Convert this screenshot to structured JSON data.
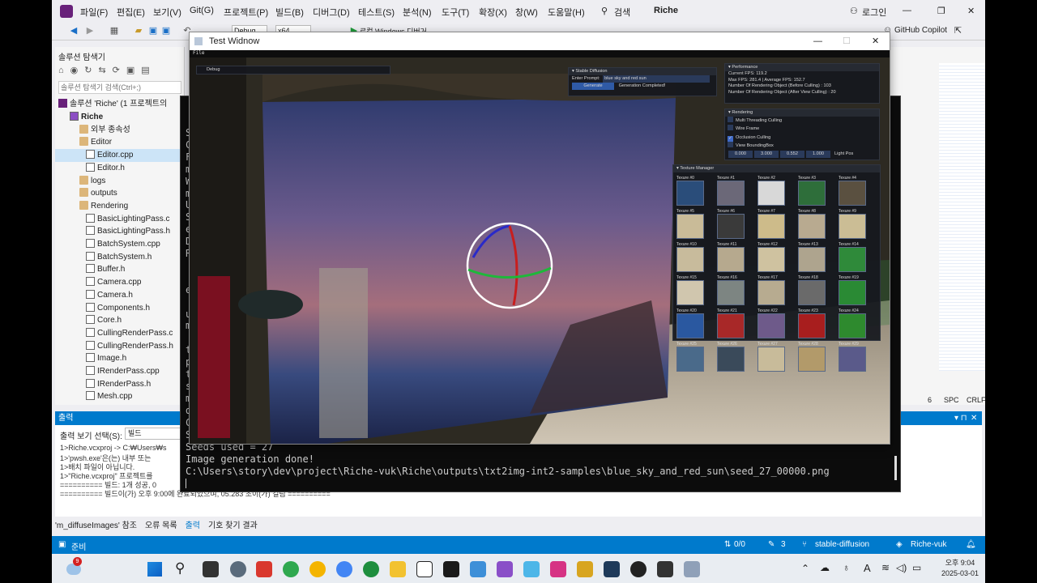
{
  "vs": {
    "menus": [
      "파일(F)",
      "편집(E)",
      "보기(V)",
      "Git(G)",
      "프로젝트(P)",
      "빌드(B)",
      "디버그(D)",
      "테스트(S)",
      "분석(N)",
      "도구(T)",
      "확장(X)",
      "창(W)",
      "도움말(H)"
    ],
    "search_label": "검색",
    "solution_name": "Riche",
    "login_label": "로그인",
    "copilot_label": "GitHub Copilot",
    "config": "Debug",
    "platform": "x64",
    "run_label": "로컬 Windows 디버거"
  },
  "solution_explorer": {
    "title": "솔루션 탐색기",
    "search_placeholder": "솔루션 탐색기 검색(Ctrl+;)",
    "solution_label": "솔루션 'Riche' (1 프로젝트의",
    "items": [
      {
        "label": "Riche",
        "kind": "project"
      },
      {
        "label": "외부 종속성",
        "kind": "folder"
      },
      {
        "label": "Editor",
        "kind": "folder"
      },
      {
        "label": "Editor.cpp",
        "kind": "file"
      },
      {
        "label": "Editor.h",
        "kind": "file"
      },
      {
        "label": "logs",
        "kind": "folder"
      },
      {
        "label": "outputs",
        "kind": "folder"
      },
      {
        "label": "Rendering",
        "kind": "folder"
      },
      {
        "label": "BasicLightingPass.c",
        "kind": "file"
      },
      {
        "label": "BasicLightingPass.h",
        "kind": "file"
      },
      {
        "label": "BatchSystem.cpp",
        "kind": "file"
      },
      {
        "label": "BatchSystem.h",
        "kind": "file"
      },
      {
        "label": "Buffer.h",
        "kind": "file"
      },
      {
        "label": "Camera.cpp",
        "kind": "file"
      },
      {
        "label": "Camera.h",
        "kind": "file"
      },
      {
        "label": "Components.h",
        "kind": "file"
      },
      {
        "label": "Core.h",
        "kind": "file"
      },
      {
        "label": "CullingRenderPass.c",
        "kind": "file"
      },
      {
        "label": "CullingRenderPass.h",
        "kind": "file"
      },
      {
        "label": "Image.h",
        "kind": "file"
      },
      {
        "label": "IRenderPass.cpp",
        "kind": "file"
      },
      {
        "label": "IRenderPass.h",
        "kind": "file"
      },
      {
        "label": "Mesh.cpp",
        "kind": "file"
      }
    ]
  },
  "right_pane": {
    "spc": "SPC",
    "crlf": "CRLF",
    "col": "6"
  },
  "output": {
    "title": "출력",
    "source_label": "출력 보기 선택(S):",
    "source_value": "빌드",
    "lines": [
      "1>Riche.vcxproj -> C:₩Users₩s",
      "1>'pwsh.exe'은(는) 내부 또는",
      "1>배치 파일이 아닙니다.",
      "1>\"Riche.vcxproj\" 프로젝트를",
      "========== 빌드: 1개 성공, 0",
      "========== 빌드이(가) 오후 9:00에 완료되었으며, 05.283 초이(가) 걸림 =========="
    ]
  },
  "bottom_tabs": [
    "'m_diffuseImages' 참조",
    "오류 목록",
    "출력",
    "기호 찾기 결과"
  ],
  "status": {
    "ready": "준비",
    "errors": "0/0",
    "pencil": "3",
    "branch": "stable-diffusion",
    "repo": "Riche-vuk"
  },
  "console": {
    "left_chars": [
      "S",
      "C",
      "F",
      "m",
      "W",
      "m",
      "U",
      "S",
      "e",
      "D",
      "R",
      "",
      "",
      "e",
      "",
      "u",
      "m",
      "",
      "t",
      "p",
      "t",
      "s",
      "m",
      "d",
      "C",
      "S"
    ],
    "lines": [
      "Seeds used = 27",
      "Image generation done!",
      "C:\\Users\\story\\dev\\project\\Riche-vuk\\Riche\\outputs\\txt2img-int2-samples\\blue_sky_and_red_sun\\seed_27_00000.png"
    ]
  },
  "test_window": {
    "title": "Test Widnow",
    "menu": "File",
    "debug_label": "Debug",
    "stable_diffusion": {
      "title": "Stable Diffusion",
      "prompt_label": "Enter Prompt:",
      "prompt_value": "blue sky and red sun",
      "generate_label": "Generate",
      "status": "Generation Completed!"
    },
    "performance": {
      "title": "Performance",
      "lines": [
        "Current FPS: 119.2",
        "Max FPS: 281.4 | Average FPS: 152.7",
        "Number Of Rendering Object (Before Culling) : 103",
        "Number Of Rendering Object (After View Culling) : 20"
      ]
    },
    "rendering": {
      "title": "Rendering",
      "options": [
        {
          "label": "Multi Threading Culling",
          "checked": false
        },
        {
          "label": "Wire Frame",
          "checked": false
        },
        {
          "label": "Occlusion Culling",
          "checked": true
        },
        {
          "label": "View BoundingBox",
          "checked": false
        }
      ],
      "light_values": [
        "0.000",
        "3.000",
        "0.552",
        "1.000"
      ],
      "light_label": "Light Pos"
    },
    "texture_manager": {
      "title": "Texture Manager",
      "textures": [
        {
          "label": "Texure #0",
          "color": "#2a4d7a"
        },
        {
          "label": "Texure #1",
          "color": "#6b6878"
        },
        {
          "label": "Texure #2",
          "color": "#d8d8d8"
        },
        {
          "label": "Texure #3",
          "color": "#2e6e3a"
        },
        {
          "label": "Texure #4",
          "color": "#5a5040"
        },
        {
          "label": "Texure #5",
          "color": "#c9bb98"
        },
        {
          "label": "Texure #6",
          "color": "#3a3a3a"
        },
        {
          "label": "Texure #7",
          "color": "#cdbb8a"
        },
        {
          "label": "Texure #8",
          "color": "#b8aa90"
        },
        {
          "label": "Texure #9",
          "color": "#cbbd95"
        },
        {
          "label": "Texure #10",
          "color": "#c8bb9c"
        },
        {
          "label": "Texure #11",
          "color": "#b6a98e"
        },
        {
          "label": "Texure #12",
          "color": "#cfc2a0"
        },
        {
          "label": "Texure #13",
          "color": "#aea48e"
        },
        {
          "label": "Texure #14",
          "color": "#2f8a3a"
        },
        {
          "label": "Texure #15",
          "color": "#d0c6ae"
        },
        {
          "label": "Texure #16",
          "color": "#7d8582"
        },
        {
          "label": "Texure #17",
          "color": "#b7ab90"
        },
        {
          "label": "Texure #18",
          "color": "#6a6a6a"
        },
        {
          "label": "Texure #19",
          "color": "#2a8a34"
        },
        {
          "label": "Texure #20",
          "color": "#2a58a0"
        },
        {
          "label": "Texure #21",
          "color": "#a82828"
        },
        {
          "label": "Texure #22",
          "color": "#6e5a8a"
        },
        {
          "label": "Texure #23",
          "color": "#a81e1e"
        },
        {
          "label": "Texure #24",
          "color": "#2e8a2e"
        },
        {
          "label": "Texure #25",
          "color": "#4a6a8a"
        },
        {
          "label": "Texure #26",
          "color": "#3a4a5a"
        },
        {
          "label": "Texure #27",
          "color": "#c8bb9a"
        },
        {
          "label": "Texure #28",
          "color": "#b29a6a"
        },
        {
          "label": "Texure #29",
          "color": "#5a5a8a"
        }
      ]
    }
  },
  "taskbar": {
    "weather_badge": "9",
    "time": "오후 9:04",
    "date": "2025-03-01",
    "ime": "A"
  }
}
